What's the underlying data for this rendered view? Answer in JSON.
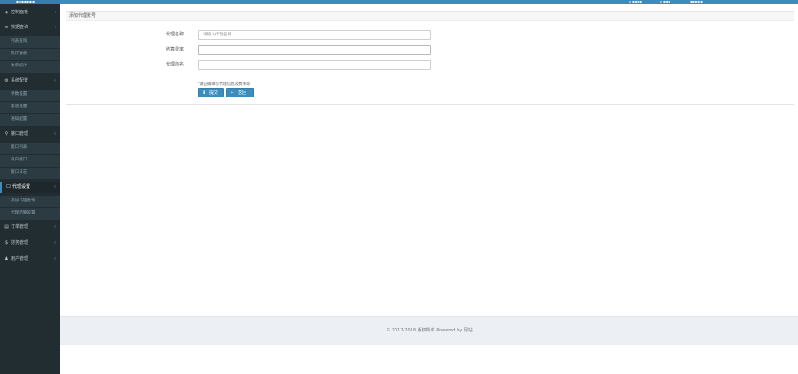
{
  "topbar": {
    "brand": "▪▪▪▪▪▪▪",
    "nav": [
      "▪ ▪▪▪▪",
      "▪ ▪▪▪",
      "▪▪▪▪ ▪"
    ]
  },
  "sidebar": {
    "items": [
      {
        "icon": "◈",
        "label": "控制面板",
        "chevron": "‹"
      },
      {
        "icon": "≡",
        "label": "数据查询",
        "chevron": "‹"
      },
      {
        "label": "列表查询"
      },
      {
        "label": "统计报表"
      },
      {
        "label": "收单统计"
      },
      {
        "icon": "⚙",
        "label": "系统配置",
        "chevron": "‹"
      },
      {
        "label": "参数设置"
      },
      {
        "label": "渠道设置"
      },
      {
        "label": "通知配置"
      },
      {
        "icon": "⚲",
        "label": "接口管理",
        "chevron": "‹"
      },
      {
        "label": "接口列表"
      },
      {
        "label": "商户接口"
      },
      {
        "label": "接口日志"
      },
      {
        "icon": "☐",
        "label": "代理设置",
        "chevron": "‹"
      },
      {
        "label": "添加代理账号"
      },
      {
        "label": "代理结算设置"
      },
      {
        "icon": "▤",
        "label": "订单管理",
        "chevron": "‹"
      },
      {
        "icon": "$",
        "label": "财务管理",
        "chevron": "‹"
      },
      {
        "icon": "♟",
        "label": "用户管理",
        "chevron": "‹"
      }
    ]
  },
  "form": {
    "title": "添加代理账号",
    "fields": [
      {
        "label": "代理名称",
        "placeholder": "请输入代理名称"
      },
      {
        "label": "结算费率",
        "placeholder": ""
      },
      {
        "label": "代理商名",
        "placeholder": ""
      }
    ],
    "hint": "*请正确填写代理信息及费率等",
    "submit": "提交",
    "back": "返回"
  },
  "footer": {
    "text": "© 2017-2018 版权所有 Powered by 网站"
  }
}
